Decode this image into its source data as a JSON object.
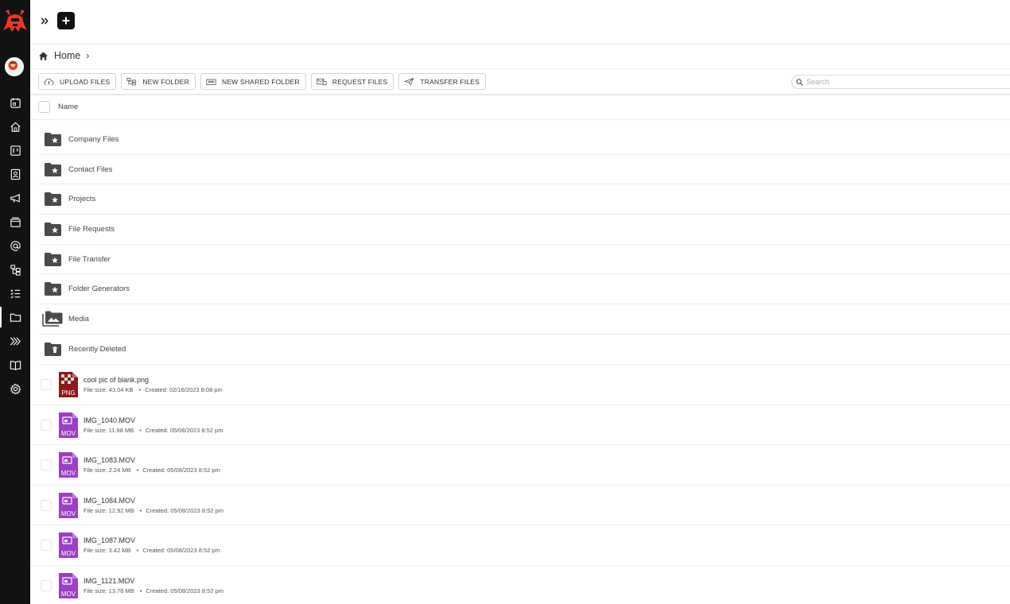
{
  "app": {
    "brand_color": "#e8392b",
    "sidebar_color": "#121212"
  },
  "sidebar": {
    "items": [
      {
        "icon": "calendar-icon"
      },
      {
        "icon": "home-icon"
      },
      {
        "icon": "board-icon"
      },
      {
        "icon": "contacts-icon"
      },
      {
        "icon": "megaphone-icon"
      },
      {
        "icon": "media-gallery-icon"
      },
      {
        "icon": "at-sign-icon"
      },
      {
        "icon": "workflow-icon"
      },
      {
        "icon": "checklist-icon"
      },
      {
        "icon": "folder-icon",
        "active": true
      },
      {
        "icon": "chevrons-right-icon"
      },
      {
        "icon": "book-icon"
      },
      {
        "icon": "gear-icon"
      }
    ]
  },
  "topbar": {
    "expand_icon": "double-chevron-right-icon",
    "add_icon": "plus-icon"
  },
  "breadcrumb": {
    "home_label": "Home",
    "separator": "›"
  },
  "toolbar": {
    "upload": "UPLOAD FILES",
    "new_folder": "NEW FOLDER",
    "new_shared_folder": "NEW SHARED FOLDER",
    "request_files": "REQUEST FILES",
    "transfer_files": "TRANSFER FILES"
  },
  "search": {
    "placeholder": "Search",
    "value": ""
  },
  "table": {
    "name_header": "Name"
  },
  "folders": [
    {
      "label": "Company Files",
      "icon": "star-folder-icon"
    },
    {
      "label": "Contact Files",
      "icon": "star-folder-icon"
    },
    {
      "label": "Projects",
      "icon": "star-folder-icon"
    },
    {
      "label": "File Requests",
      "icon": "star-folder-icon"
    },
    {
      "label": "File Transfer",
      "icon": "star-folder-icon"
    },
    {
      "label": "Folder Generators",
      "icon": "star-folder-icon"
    },
    {
      "label": "Media",
      "icon": "media-folder-icon"
    },
    {
      "label": "Recently Deleted",
      "icon": "trash-folder-icon"
    }
  ],
  "files": [
    {
      "name": "cool pic of blank.png",
      "type": "PNG",
      "size": "File size: 43.04 KB",
      "created": "Created: 02/16/2023 8:08 pm",
      "color": "#8b1a1a"
    },
    {
      "name": "IMG_1040.MOV",
      "type": "MOV",
      "size": "File size: 11.98 MB",
      "created": "Created: 05/08/2023 8:52 pm",
      "color": "#9b3fc4"
    },
    {
      "name": "IMG_1083.MOV",
      "type": "MOV",
      "size": "File size: 2.24 MB",
      "created": "Created: 05/08/2023 8:52 pm",
      "color": "#9b3fc4"
    },
    {
      "name": "IMG_1084.MOV",
      "type": "MOV",
      "size": "File size: 12.92 MB",
      "created": "Created: 05/08/2023 8:52 pm",
      "color": "#9b3fc4"
    },
    {
      "name": "IMG_1087.MOV",
      "type": "MOV",
      "size": "File size: 3.42 MB",
      "created": "Created: 05/08/2023 8:52 pm",
      "color": "#9b3fc4"
    },
    {
      "name": "IMG_1121.MOV",
      "type": "MOV",
      "size": "File size: 13.76 MB",
      "created": "Created: 05/08/2023 8:52 pm",
      "color": "#9b3fc4"
    }
  ]
}
